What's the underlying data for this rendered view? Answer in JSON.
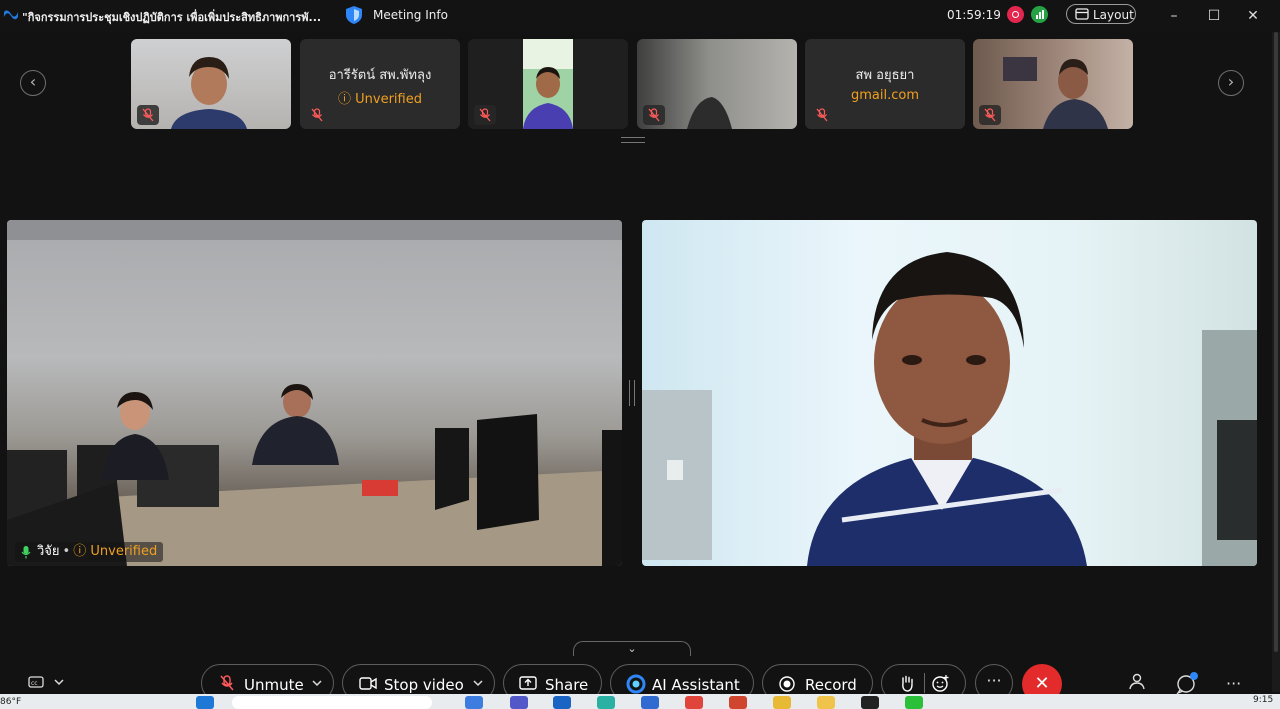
{
  "window": {
    "meeting_title": "\"กิจกรรมการประชุมเชิงปฏิบัติการ เพื่อเพิ่มประสิทธิภาพการพั...",
    "meeting_info": "Meeting Info",
    "elapsed": "01:59:19",
    "layout_label": "Layout"
  },
  "strip": {
    "participants": [
      {
        "name": "",
        "subtitle": ""
      },
      {
        "name": "อารีรัตน์  สพ.พัทลุง",
        "subtitle": "Unverified"
      },
      {
        "name": "",
        "subtitle": ""
      },
      {
        "name": "",
        "subtitle": ""
      },
      {
        "name": "สพ อยุธยา",
        "subtitle": "gmail.com"
      },
      {
        "name": "",
        "subtitle": ""
      }
    ]
  },
  "main_video": {
    "left_name": "วิจัย",
    "left_status": "Unverified"
  },
  "controls": {
    "unmute": "Unmute",
    "stop_video": "Stop video",
    "share": "Share",
    "ai_assistant": "AI Assistant",
    "record": "Record"
  },
  "taskbar": {
    "temperature": "86°F",
    "time": "9:15"
  },
  "colors": {
    "unverified": "#f0a020",
    "end_call": "#e32b2b",
    "recording": "#e2264d"
  }
}
